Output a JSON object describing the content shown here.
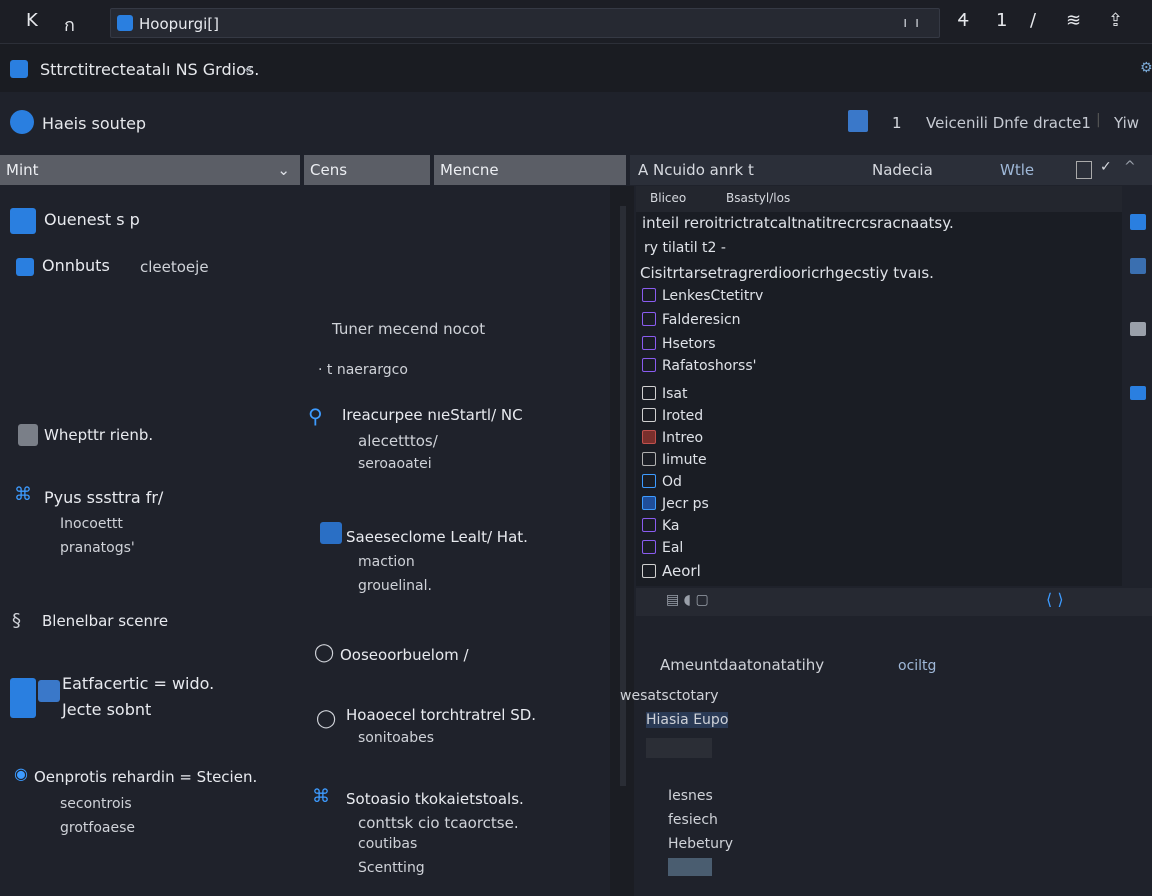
{
  "topbar": {
    "nav_back": "K",
    "nav_fwd": "ก",
    "address": "Hoopurgi[]",
    "address_tail": "ıı",
    "actions": [
      "Ꮞ",
      "1",
      "/",
      "≋",
      "⇪"
    ]
  },
  "appbar": {
    "title": "Sttrctitrecteatalı NS Grdios.",
    "title_suffix": "«"
  },
  "subbar": {
    "label": "Haeis soutep",
    "count": "1",
    "right_text": "Veicenili Dnfe dracte1",
    "right_tail": "Yiw"
  },
  "columns": {
    "c1": "Mint",
    "c2": "Cens",
    "c3": "Mencne"
  },
  "rpanel": {
    "head_title": "A Ncuido anrk t",
    "head_mid": "Nadecia",
    "head_tail": "Wtle",
    "tab1": "Bliceo",
    "tab2": "Bsastyl/los",
    "line1": "inteil reroitrictratcaltnatitrecrcsracnaatsy.",
    "line2": "ry tilatil t2 -",
    "line3": "Cisitrtarsetragrerdiooricrhgecstiy tvaıs.",
    "list_a": [
      "LenkesCtetitrv",
      "Falderesicn",
      "Hsetors",
      "Rafatoshorss'"
    ],
    "list_b": [
      "Isat",
      "Iroted",
      "Intreo",
      "Iimute",
      "Od",
      "Jecr ps",
      "Ka",
      "Eal",
      "Aeorl"
    ]
  },
  "left": {
    "item1": "Ouenest s p",
    "item2_a": "Onnbuts",
    "item2_b": "cleetoeje",
    "item3": "Whepttr rienb.",
    "item4_a": "Pyus sssttra fr/",
    "item4_b": "Inocoettt",
    "item4_c": "pranatogs'",
    "item5": "Blenelbar scenre",
    "item6_a": "Eatfacertic  = wido.",
    "item6_b": "Jecte sobnt",
    "item7_a": "Oenprotis rehardin = Stecien.",
    "item7_b": "secontrois",
    "item7_c": "grotfoaese"
  },
  "middle": {
    "m1": "Tuner mecend nocot",
    "m2": "· t naerargco",
    "m3_a": "Ireacurpee nıeStartl/ NC",
    "m3_b": "alecetttos/",
    "m3_c": "seroaoatei",
    "m4_a": "Saeeseclome Lealt/ Hat.",
    "m4_b": "maction",
    "m4_c": "grouelinal.",
    "m5": "Ooseoorbuelom /",
    "m6_a": "Hoaoecel torchtratrel SD.",
    "m6_b": "sonitoabes",
    "m7_a": "Sotoasio tkokaietstoals.",
    "m7_b": "conttsk cio tcaorctse.",
    "m7_c": "coutibas",
    "m7_d": "Scentting"
  },
  "lower_right": {
    "row1": "Ameuntdaatonatatihy",
    "row1_tail": "ociltg",
    "row2": "wesatsctotary",
    "row3": "Hiasia Eupo",
    "row4": "Iesnes",
    "row5": "fesiech",
    "row6": "Hebetury"
  },
  "colors": {
    "bg": "#1f222b",
    "accent": "#2a7fe0",
    "header": "#5b5e66"
  }
}
